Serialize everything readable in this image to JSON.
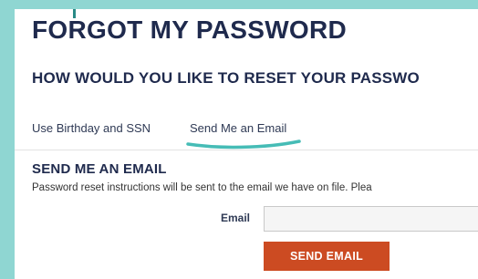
{
  "header": {
    "title": "FORGOT MY PASSWORD",
    "subtitle": "HOW WOULD YOU LIKE TO RESET YOUR PASSWO"
  },
  "tabs": [
    {
      "label": "Use Birthday and SSN",
      "active": false
    },
    {
      "label": "Send Me an Email",
      "active": true
    }
  ],
  "section": {
    "title": "SEND ME AN EMAIL",
    "description": "Password reset instructions will be sent to the email we have on file. Plea"
  },
  "form": {
    "email_label": "Email",
    "email_value": "",
    "submit_label": "SEND EMAIL"
  },
  "colors": {
    "background": "#8fd6d2",
    "heading": "#1f2a4d",
    "button": "#cc4b22",
    "underline": "#46bcb6"
  }
}
